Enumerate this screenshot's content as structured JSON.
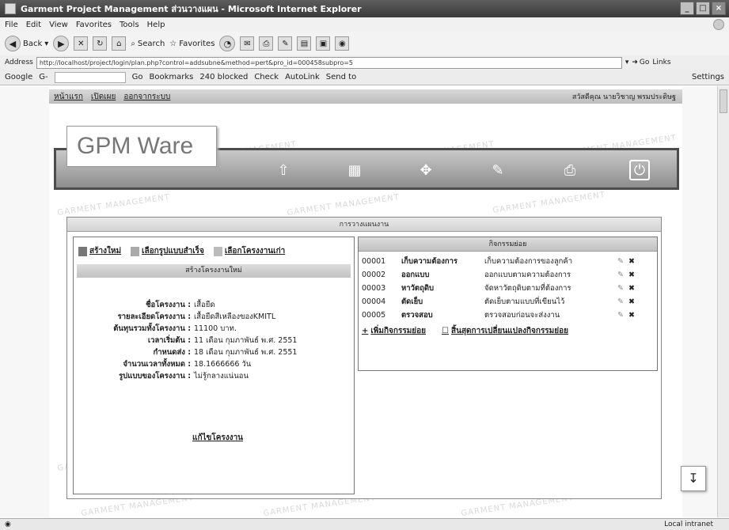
{
  "window": {
    "title": "Garment Project Management ส่วนวางแผน - Microsoft Internet Explorer",
    "buttons": {
      "minimize": "_",
      "maximize": "□",
      "close": "×"
    }
  },
  "menu": [
    "File",
    "Edit",
    "View",
    "Favorites",
    "Tools",
    "Help"
  ],
  "toolbar": {
    "back": "Back",
    "search": "Search",
    "favorites": "Favorites"
  },
  "address": {
    "label": "Address",
    "url": "http://localhost/project/login/plan.php?control=addsubne&method=pert&pro_id=000458subpro=5",
    "go": "Go",
    "links": "Links"
  },
  "googlebar": {
    "label": "Google",
    "prefix": "G-",
    "go": "Go",
    "bookmarks": "Bookmarks",
    "blocked": "240 blocked",
    "check": "Check",
    "autolink": "AutoLink",
    "sendto": "Send to",
    "settings": "Settings"
  },
  "userbar": {
    "links": [
      "หน้าแรก",
      "เปิดเผย",
      "ออกจากระบบ"
    ],
    "user": "สวัสดีคุณ นายวิชาญ พรมประดิษฐ"
  },
  "logo": {
    "text": "GPM Ware"
  },
  "panel": {
    "title": "การวางแผนงาน",
    "actions": [
      "สร้างใหม่",
      "เลือกรูปแบบสำเร็จ",
      "เลือกโครงงานเก่า"
    ],
    "subheader": "สร้างโครงงานใหม่",
    "details": [
      {
        "label": "ชื่อโครงงาน :",
        "value": "เสื้อยืด"
      },
      {
        "label": "รายละเอียดโครงงาน :",
        "value": "เสื้อยืดสีเหลืองของKMITL"
      },
      {
        "label": "ต้นทุนรวมทั้งโครงงาน :",
        "value": "11100 บาท."
      },
      {
        "label": "เวลาเริ่มต้น :",
        "value": "11 เดือน กุมภาพันธ์ พ.ศ. 2551"
      },
      {
        "label": "กำหนดส่ง :",
        "value": "18 เดือน กุมภาพันธ์ พ.ศ. 2551"
      },
      {
        "label": "จำนวนเวลาทั้งหมด :",
        "value": "18.1666666 วัน"
      },
      {
        "label": "รูปแบบของโครงงาน :",
        "value": "ไม่รู้กลางแน่นอน"
      }
    ],
    "edit_link": "แก้ไขโครงงาน"
  },
  "tasks": {
    "title": "กิจกรรมย่อย",
    "rows": [
      {
        "code": "00001",
        "name": "เก็บความต้องการ",
        "desc": "เก็บความต้องการของลูกค้า"
      },
      {
        "code": "00002",
        "name": "ออกแบบ",
        "desc": "ออกแบบตามความต้องการ"
      },
      {
        "code": "00003",
        "name": "หาวัตถุดิบ",
        "desc": "จัดหาวัตถุดิบตามที่ต้องการ"
      },
      {
        "code": "00004",
        "name": "ตัดเย็บ",
        "desc": "ตัดเย็บตามแบบที่เขียนไว้"
      },
      {
        "code": "00005",
        "name": "ตรวจสอบ",
        "desc": "ตรวจสอบก่อนจะส่งงาน"
      }
    ],
    "add_link": "เพิ่มกิจกรรมย่อย",
    "history_link": "สิ้นสุดการเปลี่ยนแปลงกิจกรรมย่อย"
  },
  "watermark": "GARMENT MANAGEMENT",
  "status": {
    "zone": "Local intranet"
  },
  "icons": {
    "edit": "✎",
    "delete": "✖",
    "add": "+",
    "float": "↧"
  }
}
